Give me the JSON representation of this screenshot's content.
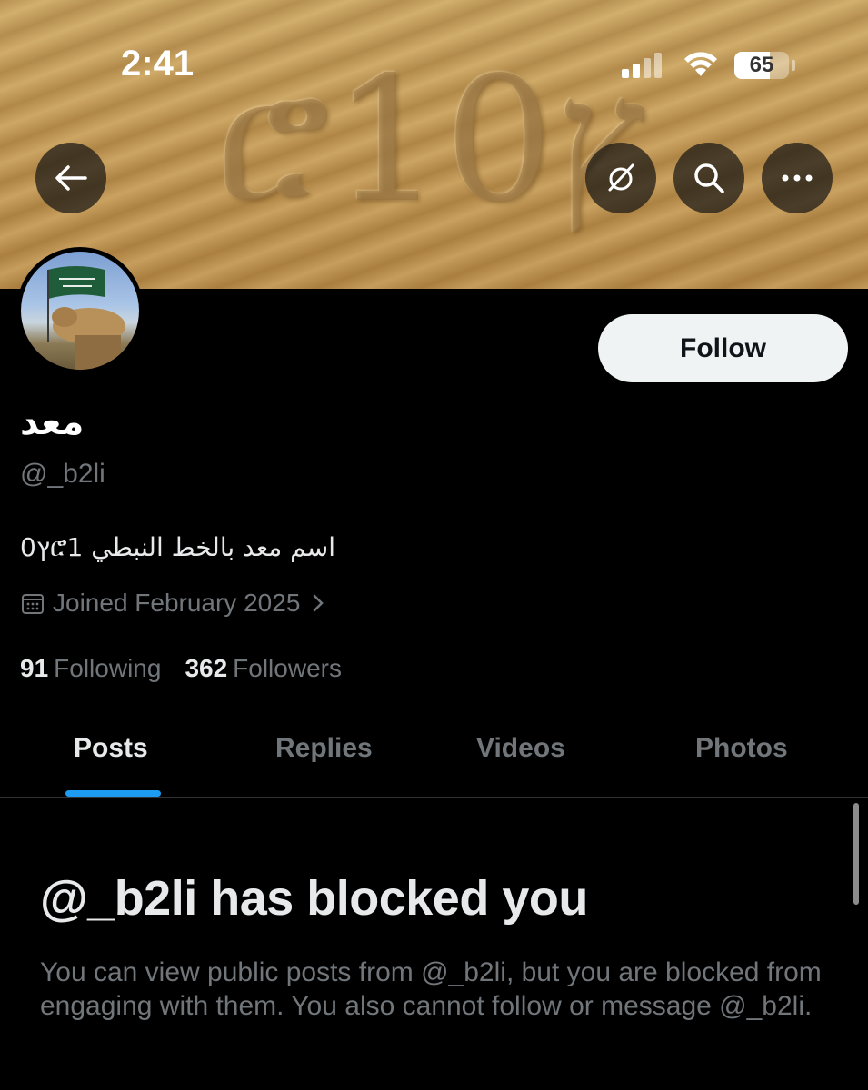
{
  "status_bar": {
    "time": "2:41",
    "battery_level": "65",
    "battery_fraction": 0.65
  },
  "banner": {
    "art_text": "ሮ1ץ0"
  },
  "header_buttons": {
    "back_icon": "arrow-left-icon",
    "grok_icon": "grok-icon",
    "search_icon": "search-icon",
    "more_icon": "ellipsis-icon"
  },
  "profile": {
    "display_name": "معد",
    "handle": "@_b2li",
    "bio": "اسم معد بالخط النبطي ሮ1ץ0",
    "joined": "Joined February 2025",
    "following_count": "91",
    "following_label": "Following",
    "followers_count": "362",
    "followers_label": "Followers",
    "follow_label": "Follow"
  },
  "tabs": [
    {
      "label": "Posts",
      "active": true
    },
    {
      "label": "Replies",
      "active": false
    },
    {
      "label": "Videos",
      "active": false
    },
    {
      "label": "Photos",
      "active": false
    }
  ],
  "blocked": {
    "title": "@_b2li has blocked you",
    "message": "You can view public posts from @_b2li, but you are blocked from engaging with them. You also cannot follow or message @_b2li."
  },
  "colors": {
    "accent": "#1d9bf0",
    "background": "#000000",
    "muted_text": "#71767b"
  }
}
